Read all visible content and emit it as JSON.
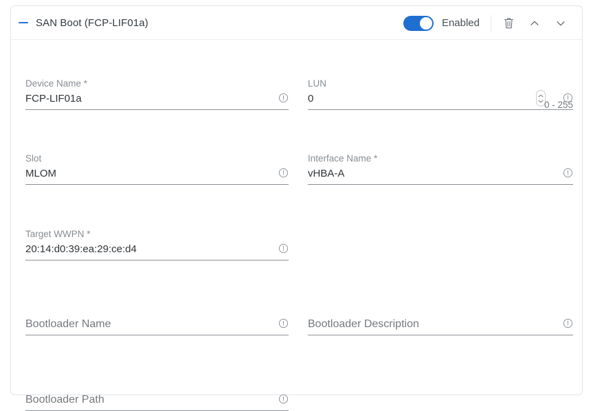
{
  "card": {
    "title": "SAN Boot (FCP-LIF01a)",
    "collapse_icon": "minus-icon",
    "toggle": {
      "label": "Enabled",
      "state": "on",
      "color": "#1f6fd0"
    },
    "actions": [
      {
        "name": "delete-button",
        "icon": "trash-icon"
      },
      {
        "name": "move-up-button",
        "icon": "chevron-up-icon"
      },
      {
        "name": "move-down-button",
        "icon": "chevron-down-icon"
      }
    ]
  },
  "fields": {
    "device_name": {
      "label": "Device Name *",
      "value": "FCP-LIF01a",
      "info_icon": "info-icon"
    },
    "lun": {
      "label": "LUN",
      "value": "0",
      "hint": "0 - 255",
      "info_icon": "info-icon",
      "stepper_icon": "stepper-updown-icon"
    },
    "slot": {
      "label": "Slot",
      "value": "MLOM",
      "info_icon": "info-icon"
    },
    "interface_name": {
      "label": "Interface Name *",
      "value": "vHBA-A",
      "info_icon": "info-icon"
    },
    "target_wwpn": {
      "label": "Target WWPN *",
      "value": "20:14:d0:39:ea:29:ce:d4",
      "info_icon": "info-icon"
    },
    "bootloader_name": {
      "placeholder": "Bootloader Name",
      "value": "",
      "info_icon": "info-icon"
    },
    "bootloader_description": {
      "placeholder": "Bootloader Description",
      "value": "",
      "info_icon": "info-icon"
    },
    "bootloader_path": {
      "placeholder": "Bootloader Path",
      "value": "",
      "info_icon": "info-icon"
    }
  }
}
